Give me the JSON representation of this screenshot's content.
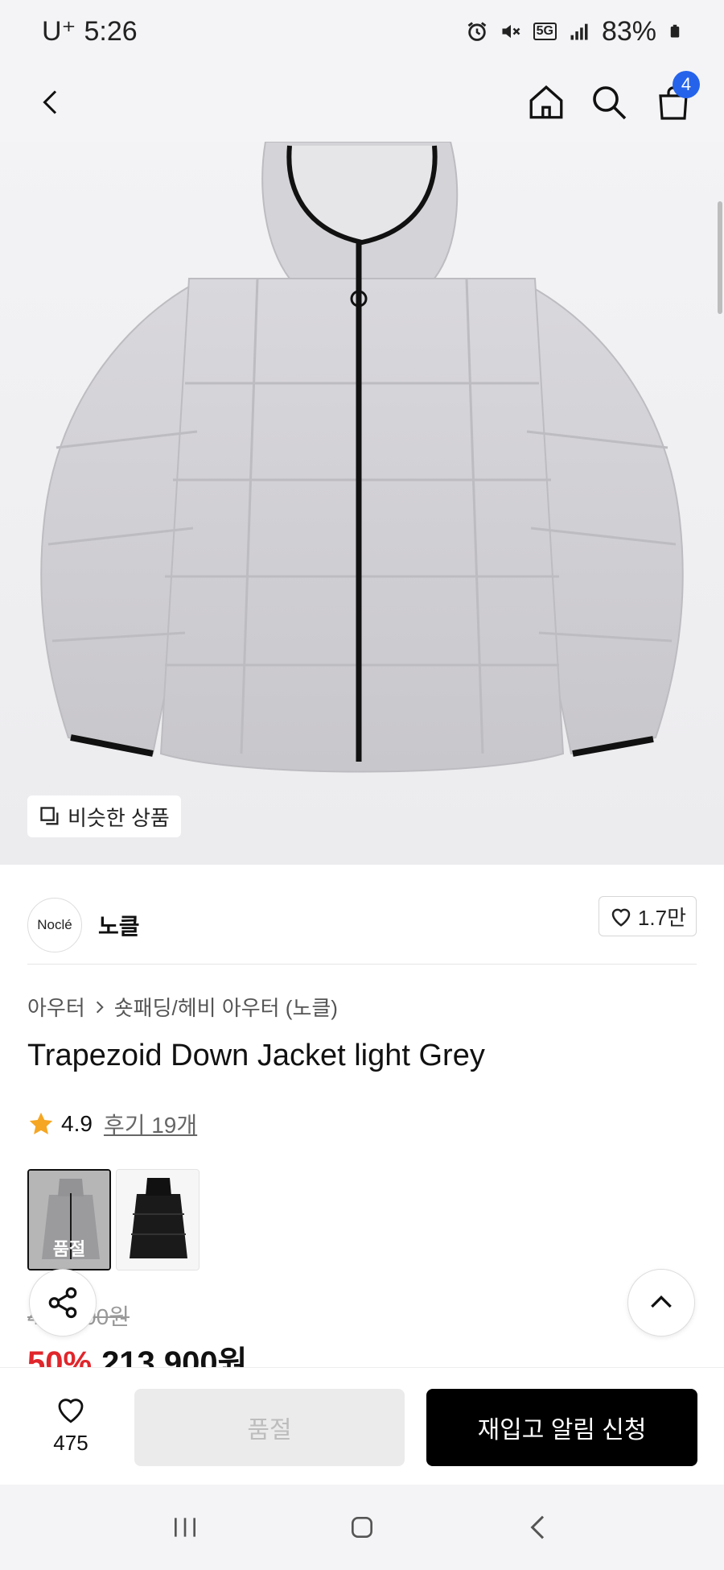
{
  "status_bar": {
    "carrier": "U⁺",
    "time": "5:26",
    "network": "5G",
    "battery": "83%"
  },
  "nav": {
    "cart_count": "4",
    "icons": [
      "back-icon",
      "home-icon",
      "search-icon",
      "cart-icon"
    ]
  },
  "product": {
    "similar_label": "비슷한 상품",
    "brand_logo_text": "Noclé",
    "brand_name": "노클",
    "brand_likes": "1.7만",
    "category": "아우터",
    "subcategory": "숏패딩/헤비 아우터 (노클)",
    "title": "Trapezoid Down Jacket light Grey",
    "rating": "4.9",
    "reviews_label": "후기 19개",
    "soldout_overlay": "품절",
    "original_price": "427,900원",
    "discount": "50%",
    "sale_price": "213,900원"
  },
  "purchase_bar": {
    "wish_count": "475",
    "soldout_button": "품절",
    "restock_button": "재입고 알림 신청"
  },
  "colors": {
    "accent_blue": "#2563eb",
    "discount_red": "#e0262b",
    "star": "#f5a623",
    "cta_black": "#000000"
  }
}
